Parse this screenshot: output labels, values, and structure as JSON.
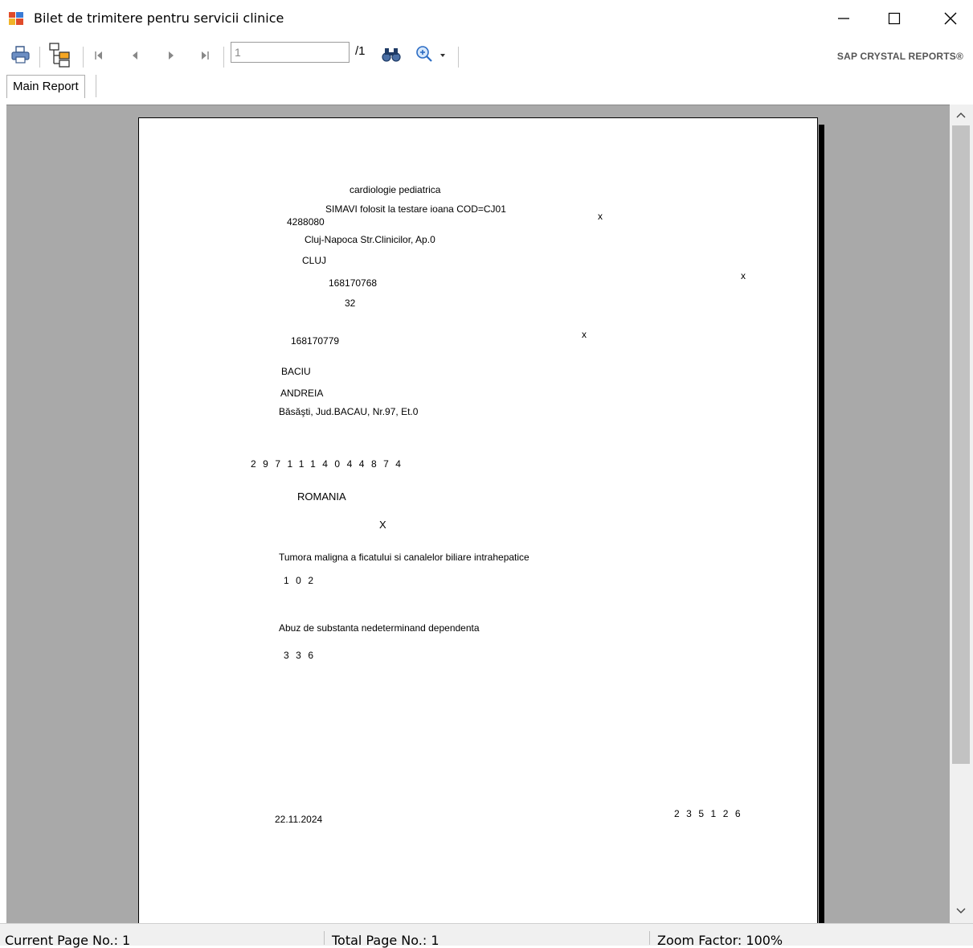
{
  "window": {
    "title": "Bilet de trimitere pentru servicii clinice",
    "minimize_glyph": "—",
    "maximize_glyph": "☐",
    "close_glyph": "✕"
  },
  "toolbar": {
    "page_value": "1",
    "page_total": "/1",
    "brand": "SAP CRYSTAL REPORTS®",
    "icons": [
      "print-icon",
      "group-tree-icon",
      "first-page-icon",
      "previous-page-icon",
      "next-page-icon",
      "last-page-icon",
      "find-icon",
      "zoom-icon"
    ]
  },
  "tabs": {
    "main_report": "Main Report"
  },
  "report": {
    "specialty": "cardiologie pediatrica",
    "unit_name": "SIMAVI folosit la testare ioana COD=CJ01",
    "mark1": "x",
    "fiscal_code": "4288080",
    "address": "Cluj-Napoca Str.Clinicilor, Ap.0",
    "county": "CLUJ",
    "contract_number": "168170768",
    "mark2": "x",
    "house": "32",
    "doctor_code": "168170779",
    "mark3": "x",
    "last_name": "BACIU",
    "first_name": "ANDREIA",
    "patient_address": "Băsăşti, Jud.BACAU, Nr.97, Et.0",
    "cnp": "2971114044874",
    "country": "ROMANIA",
    "mark4": "X",
    "diagnosis1": "Tumora maligna a ficatului si canalelor biliare intrahepatice",
    "diagnosis1_code": "102",
    "diagnosis2": "Abuz de substanta nedeterminand dependenta",
    "diagnosis2_code": "336",
    "date": "22.11.2024",
    "doctor_stamp": "235126"
  },
  "status": {
    "current_page": "Current Page No.: 1",
    "total_page": "Total Page No.: 1",
    "zoom": "Zoom Factor: 100%"
  }
}
